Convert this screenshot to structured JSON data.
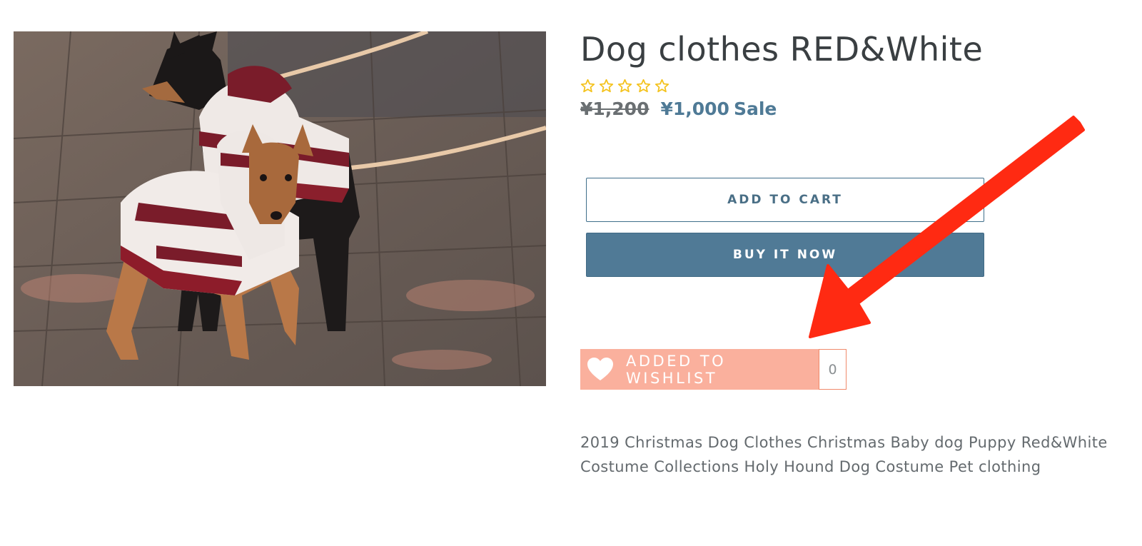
{
  "product": {
    "title": "Dog clothes RED&White",
    "rating": {
      "stars_filled": 0,
      "stars_total": 5
    },
    "price_original": "¥1,200",
    "price_sale": "¥1,000",
    "sale_label": "Sale",
    "description": "2019 Christmas Dog Clothes Christmas Baby dog Puppy Red&White Costume Collections Holy Hound Dog Costume Pet clothing"
  },
  "buttons": {
    "add_to_cart": "ADD TO CART",
    "buy_it_now": "BUY IT NOW"
  },
  "wishlist": {
    "label": "ADDED TO WISHLIST",
    "count": "0",
    "icon": "heart-icon"
  },
  "colors": {
    "accent_blue": "#507a96",
    "wishlist_bg": "#fab09d",
    "star": "#f4c21b",
    "arrow": "#ff2a12"
  }
}
